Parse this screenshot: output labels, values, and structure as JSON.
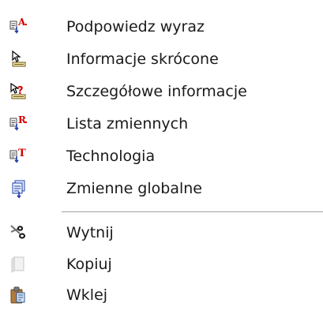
{
  "menu": {
    "items": [
      {
        "label": "Podpowiedz wyraz",
        "icon": "suggest-word-icon"
      },
      {
        "label": "Informacje skrócone",
        "icon": "short-info-icon"
      },
      {
        "label": "Szczegółowe informacje",
        "icon": "detailed-info-icon"
      },
      {
        "label": "Lista zmiennych",
        "icon": "variables-list-icon"
      },
      {
        "label": "Technologia",
        "icon": "technology-icon"
      },
      {
        "label": "Zmienne globalne",
        "icon": "global-variables-icon"
      },
      {
        "label": "Wytnij",
        "icon": "scissors-icon"
      },
      {
        "label": "Kopiuj",
        "icon": "copy-icon"
      },
      {
        "label": "Wklej",
        "icon": "paste-icon"
      }
    ]
  }
}
